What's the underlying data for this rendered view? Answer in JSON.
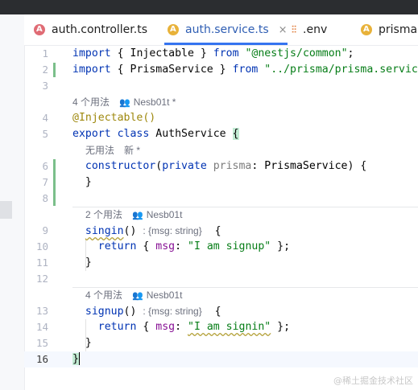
{
  "tabs": [
    {
      "label": "auth.controller.ts",
      "icon": "angular-icon"
    },
    {
      "label": "auth.service.ts",
      "icon": "angular-icon",
      "active": true
    },
    {
      "label": ".env",
      "icon": "settings-icon"
    },
    {
      "label": "prisma.s",
      "icon": "angular-icon"
    }
  ],
  "close_glyph": "×",
  "line_numbers": [
    "1",
    "2",
    "3",
    "4",
    "5",
    "6",
    "7",
    "8",
    "9",
    "10",
    "11",
    "12",
    "13",
    "14",
    "15",
    "16"
  ],
  "code": {
    "l1": {
      "kw": "import",
      "o": "{",
      "name": "Injectable",
      "c": "}",
      "from": "from",
      "str": "\"@nestjs/common\"",
      "end": ";"
    },
    "l2": {
      "kw": "import",
      "o": "{",
      "name": "PrismaService",
      "c": "}",
      "from": "from",
      "str": "\"../prisma/prisma.servic"
    },
    "l4": {
      "dec": "@Injectable()"
    },
    "l5": {
      "kw1": "export",
      "kw2": "class",
      "name": "AuthService",
      "brace": "{"
    },
    "l6": {
      "name": "constructor",
      "paren": "(",
      "kw": "private",
      "param": "prisma",
      "colon": ":",
      "type": "PrismaService",
      "close": ") {"
    },
    "l7": {
      "text": "}"
    },
    "l9": {
      "name": "singin",
      "parens": "()",
      "inlay": ": {msg: string}",
      "brace": "{"
    },
    "l10": {
      "kw": "return",
      "o": "{",
      "prop": "msg",
      "colon": ":",
      "str": "\"I am signup\"",
      "c": "};"
    },
    "l11": {
      "text": "}"
    },
    "l13": {
      "name": "signup",
      "parens": "()",
      "inlay": ": {msg: string}",
      "brace": "{"
    },
    "l14": {
      "kw": "return",
      "o": "{",
      "prop": "msg",
      "colon": ":",
      "str": "\"I am signin\"",
      "c": "};"
    },
    "l15": {
      "text": "}"
    },
    "l16": {
      "text": "}"
    }
  },
  "hints": {
    "class_usages": "4 个用法",
    "class_author": "Nesb01t *",
    "ctor_usages": "无用法",
    "ctor_author": "新 *",
    "singin_usages": "2 个用法",
    "singin_author": "Nesb01t",
    "signup_usages": "4 个用法",
    "signup_author": "Nesb01t"
  },
  "watermark": "@稀土掘金技术社区",
  "colors": {
    "accent": "#3574f0",
    "keyword": "#0033b3",
    "string": "#067d17",
    "decorator": "#9e880d",
    "property": "#871094",
    "modified_marker": "#7bbf8a"
  }
}
